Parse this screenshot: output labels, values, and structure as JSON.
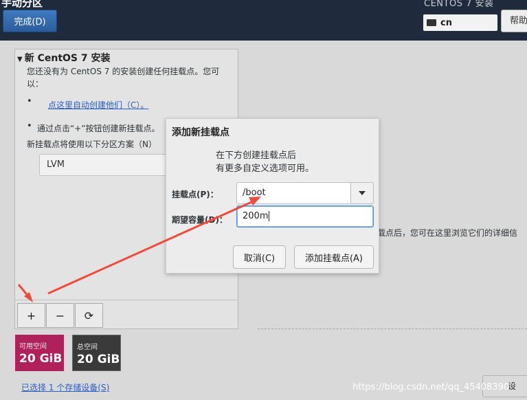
{
  "header": {
    "page_title": "手动分区",
    "done_label": "完成(D)",
    "installer_title": "CENTOS 7 安装",
    "keyboard_layout": "cn",
    "help_label": "帮助"
  },
  "left_panel": {
    "section_title": "新 CentOS 7 安装",
    "intro_line1": "您还没有为 CentOS 7 的安装创建任何挂载点。您可",
    "intro_line2": "以：",
    "bullet_symbol": "•",
    "auto_create_link": "点这里自动创建他们（C）。",
    "plus_hint": "通过点击“+”按钮创建新挂载点。",
    "scheme_hint": "新挂载点将使用以下分区方案（N）",
    "scheme_value": "LVM",
    "tools": {
      "add": "+",
      "remove": "−",
      "refresh": "⟳"
    }
  },
  "space": {
    "available_label": "可用空间",
    "available_value": "20 GiB",
    "total_label": "总空间",
    "total_value": "20 GiB"
  },
  "storage_link": "已选择 1 个存储设备(S)",
  "right_note": "载点后，您可在这里浏览它们的详细信",
  "corner_button": "设",
  "watermark": "https://blog.csdn.net/qq_45408390",
  "dialog": {
    "title": "添加新挂载点",
    "desc_line1": "在下方创建挂载点后",
    "desc_line2": "有更多自定义选项可用。",
    "mount_point_label": "挂载点(P)：",
    "mount_point_value": "/boot",
    "capacity_label": "期望容量(D)：",
    "capacity_value": "200m",
    "cancel_label": "取消(C)",
    "add_label": "添加挂载点(A)"
  },
  "colors": {
    "header_bg": "#1f2b3d",
    "primary_button": "#2b5d9c",
    "available_space": "#b0205b",
    "total_space": "#3a3a3a",
    "link": "#2c5fc4",
    "annotation_arrow": "#f04a3c"
  },
  "icons": {
    "keyboard": "keyboard-icon",
    "expander": "triangle-down-icon",
    "dropdown": "caret-down-icon",
    "refresh": "refresh-icon"
  }
}
